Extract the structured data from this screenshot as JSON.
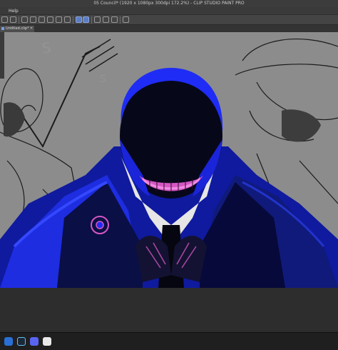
{
  "window": {
    "title": "05 Council* (1920 x 1080px 300dpi 172.2%) - CLIP STUDIO PAINT PRO"
  },
  "menu": {
    "items": [
      "Help"
    ]
  },
  "tabs": [
    {
      "label": "Untitled.clip*"
    }
  ],
  "tab_close": "×",
  "colors": {
    "canvas_gray": "#8a8a8a",
    "accent_blue": "#1f2cf5",
    "accent_magenta": "#c04ab8",
    "titlebar": "#3c3c3c"
  },
  "taskbar": {
    "icons": [
      "windows-icon",
      "steam-icon",
      "discord-icon",
      "clip-studio-icon"
    ]
  },
  "canvas": {
    "description_icons": [
      "drawing-canvas"
    ]
  }
}
